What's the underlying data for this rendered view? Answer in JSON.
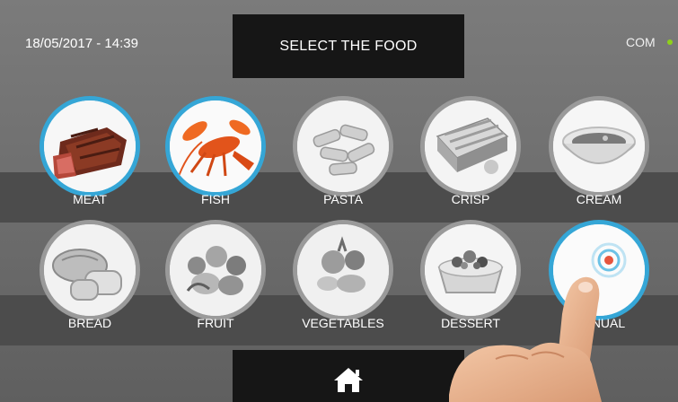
{
  "header": {
    "datetime": "18/05/2017 - 14:39",
    "title": "SELECT THE FOOD",
    "status_text": "COM",
    "status_color": "#8fd11a"
  },
  "foods": [
    {
      "label": "MEAT",
      "icon": "meat-icon",
      "selected": true
    },
    {
      "label": "FISH",
      "icon": "lobster-icon",
      "selected": true
    },
    {
      "label": "PASTA",
      "icon": "pasta-icon",
      "selected": false
    },
    {
      "label": "CRISP",
      "icon": "crisp-icon",
      "selected": false
    },
    {
      "label": "CREAM",
      "icon": "soup-bowl-icon",
      "selected": false
    },
    {
      "label": "BREAD",
      "icon": "bread-icon",
      "selected": false
    },
    {
      "label": "FRUIT",
      "icon": "fruit-icon",
      "selected": false
    },
    {
      "label": "VEGETABLES",
      "icon": "vegetables-icon",
      "selected": false
    },
    {
      "label": "DESSERT",
      "icon": "tart-icon",
      "selected": false
    },
    {
      "label": "MANUAL",
      "icon": "touch-icon",
      "selected": true
    }
  ],
  "footer": {
    "home_icon": "home-icon"
  },
  "accent_color": "#35a6d6"
}
